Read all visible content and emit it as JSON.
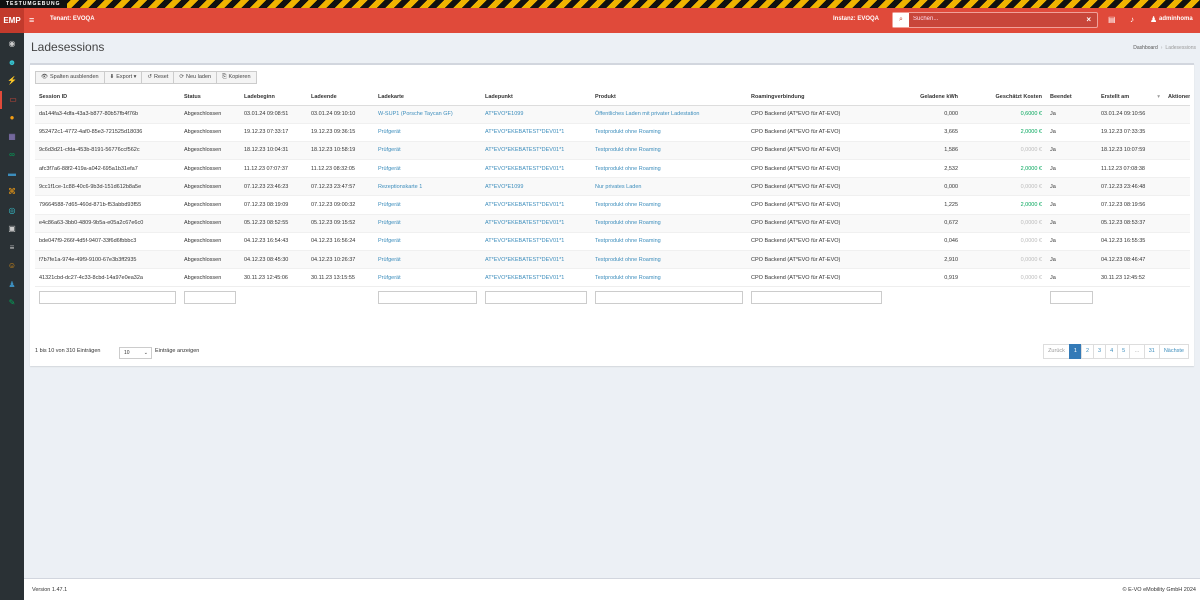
{
  "banner": {
    "text": "TESTUMGEBUNG"
  },
  "topbar": {
    "brand": "EMP",
    "tenant": "Tenant: EVOQA",
    "instanz": "Instanz: EVOQA",
    "search_placeholder": "Suchen...",
    "user": "adminhoma",
    "icons": [
      "menu-icon",
      "search-icon",
      "clear-icon",
      "tasks-icon",
      "bell-icon",
      "user-icon"
    ]
  },
  "sidebar": {
    "icons": [
      {
        "name": "dashboard-icon",
        "color": "#cccccc",
        "glyph": "◉"
      },
      {
        "name": "customer-icon",
        "color": "#36c6d3",
        "glyph": "☻"
      },
      {
        "name": "charging-icon",
        "color": "#e04a3a",
        "glyph": "⚡"
      },
      {
        "name": "session-icon",
        "color": "#e04a3a",
        "glyph": "▭"
      },
      {
        "name": "tariff-icon",
        "color": "#f39c12",
        "glyph": "●"
      },
      {
        "name": "invoice-icon",
        "color": "#8e7cc3",
        "glyph": "▦"
      },
      {
        "name": "roaming-icon",
        "color": "#00a65a",
        "glyph": "∞"
      },
      {
        "name": "card-icon",
        "color": "#3c8dbc",
        "glyph": "▬"
      },
      {
        "name": "station-icon",
        "color": "#f39c12",
        "glyph": "⌘"
      },
      {
        "name": "eye-icon",
        "color": "#36c6d3",
        "glyph": "◎"
      },
      {
        "name": "car-icon",
        "color": "#cccccc",
        "glyph": "▣"
      },
      {
        "name": "list-icon",
        "color": "#cccccc",
        "glyph": "≡"
      },
      {
        "name": "group-icon",
        "color": "#f39c12",
        "glyph": "☺"
      },
      {
        "name": "person-icon",
        "color": "#3c8dbc",
        "glyph": "♟"
      },
      {
        "name": "plug-icon",
        "color": "#00a65a",
        "glyph": "✎"
      }
    ]
  },
  "page": {
    "title": "Ladesessions",
    "breadcrumb": {
      "home": "Dashboard",
      "current": "Ladesessions"
    }
  },
  "toolbar": [
    {
      "icon": "👁",
      "label": "Spalten ausblenden",
      "name": "hide-columns-button"
    },
    {
      "icon": "⬇",
      "label": "Export ▾",
      "name": "export-button"
    },
    {
      "icon": "↺",
      "label": "Reset",
      "name": "reset-button"
    },
    {
      "icon": "⟳",
      "label": "Neu laden",
      "name": "reload-button"
    },
    {
      "icon": "⎘",
      "label": "Kopieren",
      "name": "copy-button"
    }
  ],
  "table": {
    "columns": [
      "Session ID",
      "Status",
      "Ladebeginn",
      "Ladeende",
      "Ladekarte",
      "Ladepunkt",
      "Produkt",
      "Roamingverbindung",
      "Geladene kWh",
      "Geschätzt Kosten",
      "Beendet",
      "Erstellt am",
      "Aktionen"
    ],
    "rows": [
      {
        "id": "da144fa3-4dfa-43a3-b877-80b57fb4f76b",
        "status": "Abgeschlossen",
        "start": "03.01.24 09:08:51",
        "end": "03.01.24 09:10:10",
        "card": "W-SUP1 (Porsche Taycan GF)",
        "point": "AT*EVO*E1099",
        "product": "Öffentliches Laden mit privater Ladestation",
        "roaming": "CPO Backend (AT*EVO für AT-EVO)",
        "kwh": "0,000",
        "cost": "0,6000 €",
        "cost_style": "green",
        "done": "Ja",
        "created": "03.01.24 09:10:56"
      },
      {
        "id": "952472c1-4772-4af0-85e3-721525d18036",
        "status": "Abgeschlossen",
        "start": "19.12.23 07:33:17",
        "end": "19.12.23 09:36:15",
        "card": "Prüfgerät",
        "point": "AT*EVO*EKEBATEST*DEV01*1",
        "product": "Testprodukt ohne Roaming",
        "roaming": "CPO Backend (AT*EVO für AT-EVO)",
        "kwh": "3,665",
        "cost": "2,0000 €",
        "cost_style": "green",
        "done": "Ja",
        "created": "19.12.23 07:33:35"
      },
      {
        "id": "9c6d3d21-cfda-453b-8191-56776ccf562c",
        "status": "Abgeschlossen",
        "start": "18.12.23 10:04:31",
        "end": "18.12.23 10:58:19",
        "card": "Prüfgerät",
        "point": "AT*EVO*EKEBATEST*DEV01*1",
        "product": "Testprodukt ohne Roaming",
        "roaming": "CPO Backend (AT*EVO für AT-EVO)",
        "kwh": "1,586",
        "cost": "0,0000 €",
        "cost_style": "muted",
        "done": "Ja",
        "created": "18.12.23 10:07:59"
      },
      {
        "id": "afc3f7a6-88f2-419a-a042-695a1b31efa7",
        "status": "Abgeschlossen",
        "start": "11.12.23 07:07:37",
        "end": "11.12.23 08:32:05",
        "card": "Prüfgerät",
        "point": "AT*EVO*EKEBATEST*DEV01*1",
        "product": "Testprodukt ohne Roaming",
        "roaming": "CPO Backend (AT*EVO für AT-EVO)",
        "kwh": "2,532",
        "cost": "2,0000 €",
        "cost_style": "green",
        "done": "Ja",
        "created": "11.12.23 07:08:38"
      },
      {
        "id": "9cc1f1ce-1c88-40c6-9b3d-151d612b8a5e",
        "status": "Abgeschlossen",
        "start": "07.12.23 23:46:23",
        "end": "07.12.23 23:47:57",
        "card": "Rezeptionskarte 1",
        "point": "AT*EVO*E1099",
        "product": "Nur privates Laden",
        "roaming": "CPO Backend (AT*EVO für AT-EVO)",
        "kwh": "0,000",
        "cost": "0,0000 €",
        "cost_style": "muted",
        "done": "Ja",
        "created": "07.12.23 23:46:48"
      },
      {
        "id": "79664588-7d65-460d-871b-f53abbd93f55",
        "status": "Abgeschlossen",
        "start": "07.12.23 08:19:09",
        "end": "07.12.23 09:00:32",
        "card": "Prüfgerät",
        "point": "AT*EVO*EKEBATEST*DEV01*1",
        "product": "Testprodukt ohne Roaming",
        "roaming": "CPO Backend (AT*EVO für AT-EVO)",
        "kwh": "1,225",
        "cost": "2,0000 €",
        "cost_style": "green",
        "done": "Ja",
        "created": "07.12.23 08:19:56"
      },
      {
        "id": "e4c86a63-3bb0-4809-9b5a-e05a2c67e6c0",
        "status": "Abgeschlossen",
        "start": "05.12.23 08:52:55",
        "end": "05.12.23 09:15:52",
        "card": "Prüfgerät",
        "point": "AT*EVO*EKEBATEST*DEV01*1",
        "product": "Testprodukt ohne Roaming",
        "roaming": "CPO Backend (AT*EVO für AT-EVO)",
        "kwh": "0,672",
        "cost": "0,0000 €",
        "cost_style": "muted",
        "done": "Ja",
        "created": "05.12.23 08:53:37"
      },
      {
        "id": "bde047f9-266f-4d5f-9407-33f6d6fbbbc3",
        "status": "Abgeschlossen",
        "start": "04.12.23 16:54:43",
        "end": "04.12.23 16:56:24",
        "card": "Prüfgerät",
        "point": "AT*EVO*EKEBATEST*DEV01*1",
        "product": "Testprodukt ohne Roaming",
        "roaming": "CPO Backend (AT*EVO für AT-EVO)",
        "kwh": "0,046",
        "cost": "0,0000 €",
        "cost_style": "muted",
        "done": "Ja",
        "created": "04.12.23 16:55:35"
      },
      {
        "id": "f7b7fe1a-974e-49f9-9100-67e3b3ff2935",
        "status": "Abgeschlossen",
        "start": "04.12.23 08:45:30",
        "end": "04.12.23 10:26:37",
        "card": "Prüfgerät",
        "point": "AT*EVO*EKEBATEST*DEV01*1",
        "product": "Testprodukt ohne Roaming",
        "roaming": "CPO Backend (AT*EVO für AT-EVO)",
        "kwh": "2,910",
        "cost": "0,0000 €",
        "cost_style": "muted",
        "done": "Ja",
        "created": "04.12.23 08:46:47"
      },
      {
        "id": "41321cbd-dc27-4c33-8cbd-14a97e0ea32a",
        "status": "Abgeschlossen",
        "start": "30.11.23 12:45:06",
        "end": "30.11.23 13:15:55",
        "card": "Prüfgerät",
        "point": "AT*EVO*EKEBATEST*DEV01*1",
        "product": "Testprodukt ohne Roaming",
        "roaming": "CPO Backend (AT*EVO für AT-EVO)",
        "kwh": "0,919",
        "cost": "0,0000 €",
        "cost_style": "muted",
        "done": "Ja",
        "created": "30.11.23 12:45:52"
      }
    ]
  },
  "table_info": "1 bis 10 von 310 Einträgen",
  "page_length": {
    "value": "10",
    "label": "Einträge anzeigen"
  },
  "pagination": [
    "Zurück",
    "1",
    "2",
    "3",
    "4",
    "5",
    "…",
    "31",
    "Nächste"
  ],
  "pagination_active": "1",
  "footer": {
    "version": "Version 1.47.1",
    "copyright": "© E-VO eMobility GmbH 2024"
  },
  "colors": {
    "brand": "#e04a3a",
    "sidebar": "#2a3135",
    "link": "#3c8dbc",
    "positive": "#00a65a"
  }
}
